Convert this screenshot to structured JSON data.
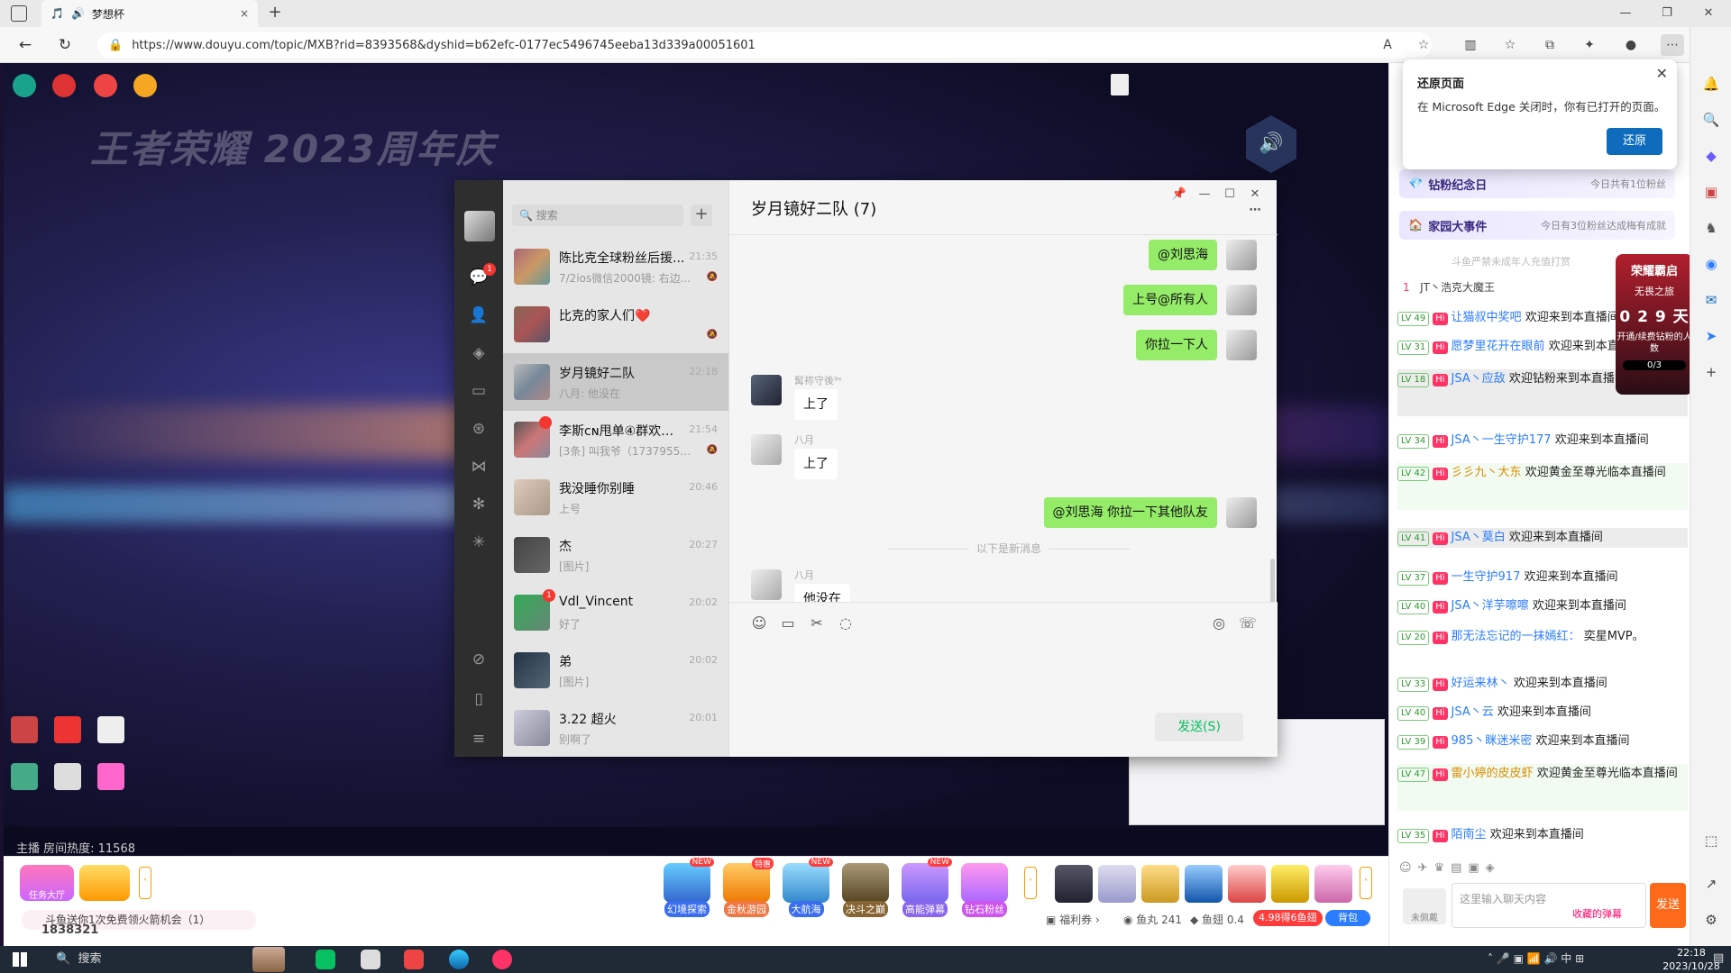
{
  "browser": {
    "tab_title": "梦想杯",
    "url": "https://www.douyu.com/topic/MXB?rid=8393568&dyshid=b62efc-0177ec5496745eeba13d339a00051601",
    "tab_close": "×",
    "new_tab": "+"
  },
  "restore_popup": {
    "title": "还原页面",
    "desc": "在 Microsoft Edge 关闭时，你有已打开的页面。",
    "button": "还原"
  },
  "stream": {
    "overlay_title": "王者荣耀 2023周年庆",
    "viewer_line": "主播 房间热度: 11568"
  },
  "wechat": {
    "search_placeholder": "搜索",
    "chat_title": "岁月镜好二队 (7)",
    "conversations": [
      {
        "name": "陈比克全球粉丝后援...",
        "time": "21:35",
        "preview": "7/2ios微信2000镜: 右边..."
      },
      {
        "name": "比克的家人们❤️",
        "time": "",
        "preview": ""
      },
      {
        "name": "岁月镜好二队",
        "time": "22:18",
        "preview": "八月: 他没在"
      },
      {
        "name": "李斯ᴄɴ甩单④群欢迎...",
        "time": "21:54",
        "preview": "[3条] 叫我爷（17379552..."
      },
      {
        "name": "我没睡你别睡",
        "time": "20:46",
        "preview": "上号"
      },
      {
        "name": "杰",
        "time": "20:27",
        "preview": "[图片]"
      },
      {
        "name": "Vdl_Vincent",
        "time": "20:02",
        "preview": "好了"
      },
      {
        "name": "弟",
        "time": "20:02",
        "preview": "[图片]"
      },
      {
        "name": "3.22 超火",
        "time": "20:01",
        "preview": "别啊了"
      }
    ],
    "messages": {
      "m1": "@刘思海",
      "m2": "上号@所有人",
      "m3": "你拉一下人",
      "s4": "髯祢守後⁹ᵉ",
      "m4": "上了",
      "s5": "八月",
      "m5": "上了",
      "m6": "@刘思海 你拉一下其他队友",
      "new_sep": "以下是新消息",
      "s7": "八月",
      "m7": "他没在"
    },
    "send_label": "发送(S)"
  },
  "gifts": [
    {
      "label": "幻境探索",
      "tag": "NEW"
    },
    {
      "label": "金秋游园",
      "tag": "特惠"
    },
    {
      "label": "大航海",
      "tag": "NEW"
    },
    {
      "label": "决斗之巅",
      "tag": ""
    },
    {
      "label": "高能弹幕",
      "tag": "NEW"
    },
    {
      "label": "钻石粉丝",
      "tag": ""
    }
  ],
  "bottom": {
    "task_hall": "任务大厅",
    "pink_note": "斗鱼送你1次免费领火箭机会（1）",
    "uid": "1838321",
    "fuli": "福利券",
    "yuwan": "鱼丸 241",
    "yuchi": "鱼翅 0.4",
    "promo": "4.98得6鱼翅",
    "backpack": "背包"
  },
  "right_panel": {
    "banner1": {
      "title": "钻粉纪念日",
      "right": "今日共有1位粉丝"
    },
    "banner2": {
      "title": "家园大事件",
      "right": "今日有3位粉丝达成梅有成就"
    },
    "notice": "斗鱼严禁未成年人充值打赏",
    "rank_line": "JT丶浩克大魔王",
    "rank_card": {
      "t1": "荣耀霸启",
      "t2": "无畏之旅",
      "t3": "开通/续费钻粉的人数",
      "counter": "0 2 9 天",
      "progress": "0/3"
    },
    "chat": [
      {
        "lv": "LV 49",
        "nick": "让猫叔中奖吧",
        "text": "欢迎来到本直播间"
      },
      {
        "lv": "LV 31",
        "nick": "愿梦里花开在眼前",
        "text": "欢迎来到本直播间"
      },
      {
        "lv": "LV 18",
        "nick": "JSA丶应敌",
        "text": "欢迎钻粉来到本直播间"
      },
      {
        "lv": "LV 34",
        "nick": "JSA丶一生守护177",
        "text": "欢迎来到本直播间"
      },
      {
        "lv": "LV 42",
        "nick": "彡彡九丶大东",
        "text": "欢迎黄金至尊光临本直播间"
      },
      {
        "lv": "LV 41",
        "nick": "JSA丶莫白",
        "text": "欢迎来到本直播间"
      },
      {
        "lv": "LV 37",
        "nick": "一生守护917",
        "text": "欢迎来到本直播间"
      },
      {
        "lv": "LV 40",
        "nick": "JSA丶洋芋嚓嚓",
        "text": "欢迎来到本直播间"
      },
      {
        "lv": "LV 20",
        "nick": "那无法忘记的一抹嫣红：",
        "text": "奕星MVP。"
      },
      {
        "lv": "LV 33",
        "nick": "好运来林丶",
        "text": "欢迎来到本直播间"
      },
      {
        "lv": "LV 40",
        "nick": "JSA丶云",
        "text": "欢迎来到本直播间"
      },
      {
        "lv": "LV 39",
        "nick": "985丶眯迷米密",
        "text": "欢迎来到本直播间"
      },
      {
        "lv": "LV 47",
        "nick": "雷小婷的皮皮虾",
        "text": "欢迎黄金至尊光临本直播间"
      },
      {
        "lv": "LV 35",
        "nick": "陌南尘",
        "text": "欢迎来到本直播间"
      }
    ],
    "input_placeholder": "这里输入聊天内容",
    "danmu": "收藏的弹幕",
    "send": "发送",
    "unlogged": "未佩戴"
  },
  "taskbar": {
    "search": "搜索",
    "time": "22:18",
    "date": "2023/10/28",
    "ime": "中"
  }
}
